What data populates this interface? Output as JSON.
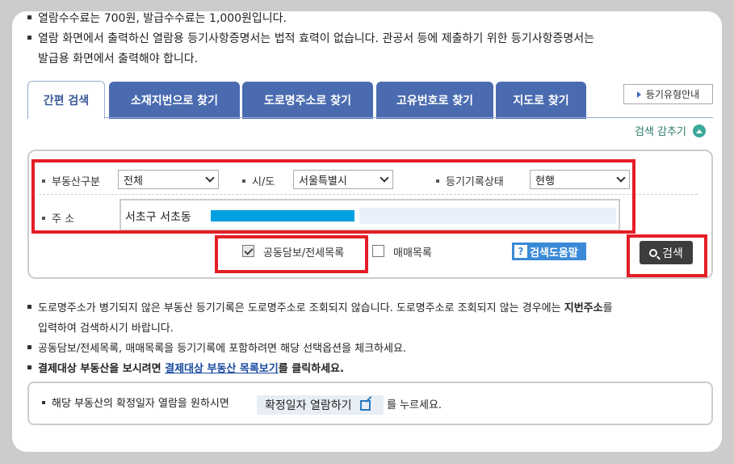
{
  "notices_top": [
    "열람수수료는 700원, 발급수수료는 1,000원입니다.",
    "열람 화면에서 출력하신 열람용 등기사항증명서는 법적 효력이 없습니다. 관공서 등에 제출하기 위한 등기사항증명서는",
    "발급용 화면에서 출력해야 합니다."
  ],
  "tabs": [
    {
      "label": "간편 검색"
    },
    {
      "label": "소재지번으로 찾기"
    },
    {
      "label": "도로명주소로 찾기"
    },
    {
      "label": "고유번호로 찾기"
    },
    {
      "label": "지도로 찾기"
    }
  ],
  "registry_type_button": "등기유형안내",
  "hide_search_link": "검색 감추기",
  "form": {
    "property_type_label": "부동산구분",
    "property_type_value": "전체",
    "sido_label": "시/도",
    "sido_value": "서울특별시",
    "record_status_label": "등기기록상태",
    "record_status_value": "현행",
    "address_label": "주 소",
    "address_value": "서초구 서초동"
  },
  "options": {
    "joint_collateral_label": "공동담보/전세목록",
    "joint_collateral_checked": true,
    "sales_list_label": "매매목록",
    "sales_list_checked": false
  },
  "help_button": "검색도움말",
  "search_button": "검색",
  "notices_bottom": {
    "line1": "도로명주소가 병기되지 않은 부동산 등기기록은 도로명주소로 조회되지 않습니다. 도로명주소로 조회되지 않는 경우에는",
    "line1_bold": "지번주소",
    "line1_end": "를",
    "line2": "입력하여 검색하시기 바랍니다.",
    "line3": "공동담보/전세목록, 매매목록을 등기기록에 포함하려면 해당 선택옵션을 체크하세요.",
    "line4_start": "결제대상 부동산을 보시려면",
    "line4_link": "결제대상 부동산 목록보기",
    "line4_end": "를 클릭하세요."
  },
  "confirm_note": {
    "before": "해당 부동산의 확정일자 열람을 원하시면",
    "button": "확정일자 열람하기",
    "after": "를 누르세요."
  },
  "colors": {
    "tab_bg": "#4a6bb0",
    "highlight_red": "#e41e26",
    "address_highlight": "#00a0e0",
    "help_btn": "#3a8ad8",
    "search_btn": "#3d3d3d"
  }
}
